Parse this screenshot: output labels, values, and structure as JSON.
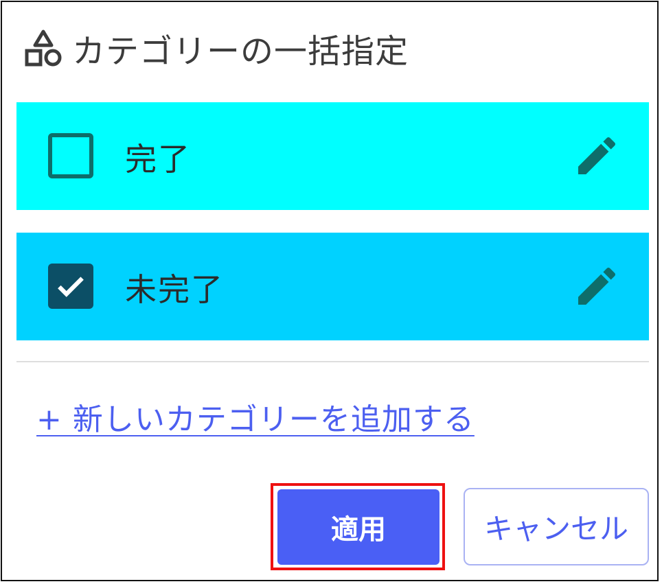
{
  "dialog": {
    "title": "カテゴリーの一括指定",
    "title_icon": "shapes-icon"
  },
  "categories": [
    {
      "label": "完了",
      "checked": false,
      "color": "#00ffff",
      "edit_icon": "pencil-icon"
    },
    {
      "label": "未完了",
      "checked": true,
      "color": "#00d2ff",
      "edit_icon": "pencil-icon"
    }
  ],
  "add_category_link": "+ 新しいカテゴリーを追加する",
  "buttons": {
    "apply": "適用",
    "cancel": "キャンセル"
  },
  "colors": {
    "accent": "#4a5ff5",
    "checkbox": "#0c4f66",
    "highlight_outline": "#ee1111"
  }
}
